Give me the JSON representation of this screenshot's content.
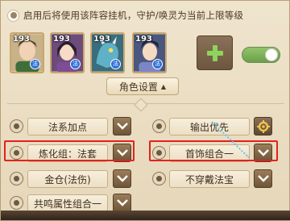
{
  "top_note": "启用后将使用该阵容挂机，守护/唤灵为当前上限等级",
  "party": [
    {
      "level": "193",
      "badge": "法",
      "bg": "#c7b28a",
      "hair": "#4a3526",
      "robe": "#3f6e3a"
    },
    {
      "level": "193",
      "badge": "法",
      "bg": "#6d4b7a",
      "hair": "#2b1e2e",
      "robe": "#7d4d95"
    },
    {
      "level": "193",
      "badge": "法",
      "bg": "#3a6d7d",
      "hair": "#1d3f55",
      "robe": "#5fb1c7"
    },
    {
      "level": "193",
      "badge": "法",
      "bg": "#4b587d",
      "hair": "#1e233a",
      "robe": "#7a86c6"
    }
  ],
  "role_settings_label": "角色设置",
  "role_settings_arrow": "▲",
  "rows": {
    "left": [
      "法系加点",
      "炼化组：法套",
      "金仓(法伤)",
      "共鸣属性组合一"
    ],
    "right": [
      "输出优先",
      "首饰组合一",
      "不穿戴法宝"
    ]
  },
  "colors": {
    "highlight": "#e2221f",
    "toggle_on": "#7ab356",
    "dropdown_btn": "#7d6344"
  }
}
